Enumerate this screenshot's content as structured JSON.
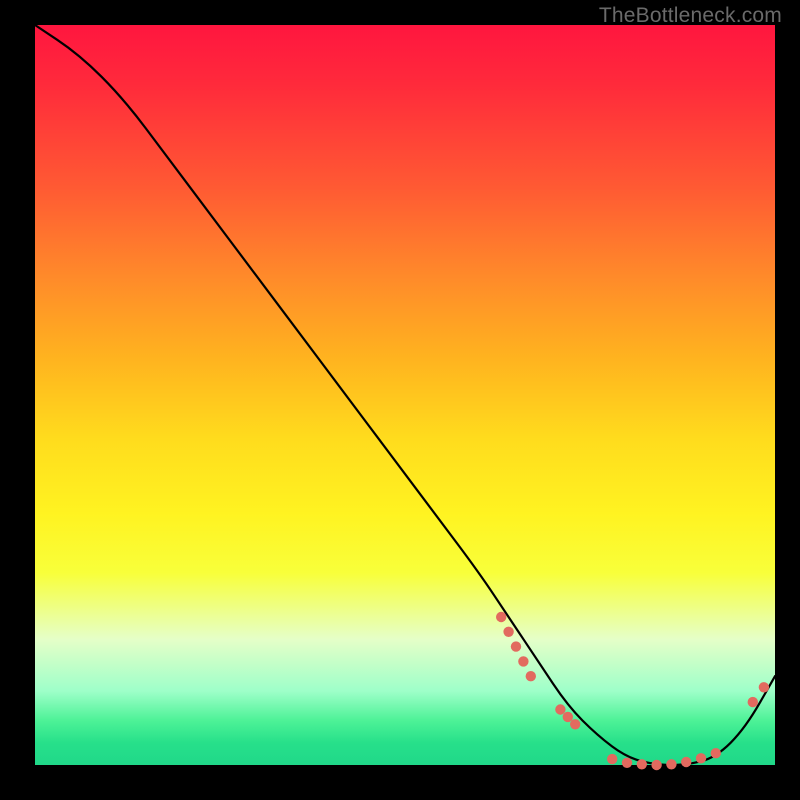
{
  "watermark": "TheBottleneck.com",
  "colors": {
    "marker": "#e26a5f",
    "curve": "#000000"
  },
  "chart_data": {
    "type": "line",
    "title": "",
    "xlabel": "",
    "ylabel": "",
    "xlim": [
      0,
      100
    ],
    "ylim": [
      0,
      100
    ],
    "grid": false,
    "curve": {
      "x": [
        0,
        6,
        12,
        18,
        24,
        30,
        36,
        42,
        48,
        54,
        60,
        64,
        68,
        72,
        76,
        80,
        84,
        88,
        92,
        96,
        100
      ],
      "y": [
        100,
        96,
        90,
        82,
        74,
        66,
        58,
        50,
        42,
        34,
        26,
        20,
        14,
        8,
        4,
        1,
        0,
        0,
        1,
        5,
        12
      ]
    },
    "marker_clusters": [
      {
        "label": "",
        "points": [
          {
            "x": 63,
            "y": 20
          },
          {
            "x": 64,
            "y": 18
          },
          {
            "x": 65,
            "y": 16
          },
          {
            "x": 66,
            "y": 14
          },
          {
            "x": 67,
            "y": 12
          }
        ]
      },
      {
        "label": "",
        "points": [
          {
            "x": 71,
            "y": 7.5
          },
          {
            "x": 72,
            "y": 6.5
          },
          {
            "x": 73,
            "y": 5.5
          }
        ]
      },
      {
        "label": "",
        "points": [
          {
            "x": 78,
            "y": 0.8
          },
          {
            "x": 80,
            "y": 0.3
          },
          {
            "x": 82,
            "y": 0.1
          },
          {
            "x": 84,
            "y": 0.0
          },
          {
            "x": 86,
            "y": 0.1
          },
          {
            "x": 88,
            "y": 0.4
          },
          {
            "x": 90,
            "y": 0.9
          },
          {
            "x": 92,
            "y": 1.6
          }
        ]
      },
      {
        "label": "",
        "points": [
          {
            "x": 97,
            "y": 8.5
          },
          {
            "x": 98.5,
            "y": 10.5
          }
        ]
      }
    ]
  }
}
